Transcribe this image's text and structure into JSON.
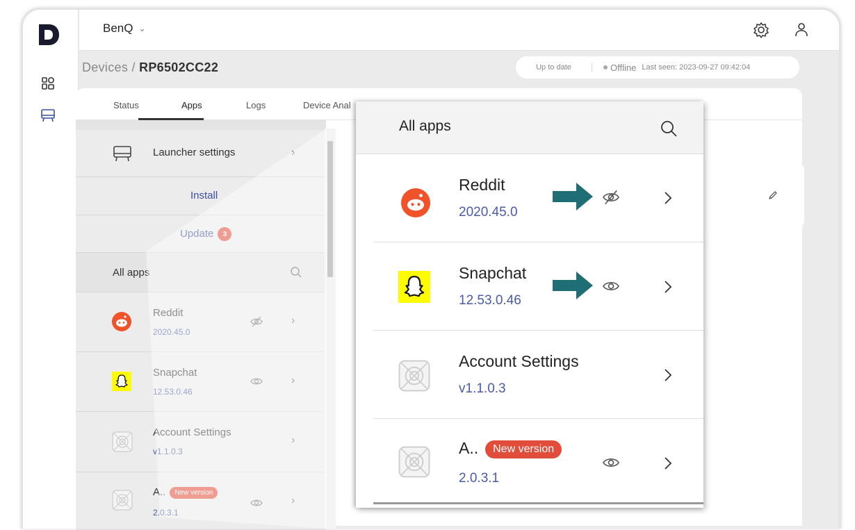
{
  "org": {
    "name": "BenQ"
  },
  "breadcrumb": {
    "root": "Devices",
    "separator": "/",
    "current": "RP6502CC22"
  },
  "status": {
    "update": "Up to date",
    "connection": "Offline",
    "last_seen": "Last seen: 2023-09-27 09:42:04"
  },
  "tabs": [
    "Status",
    "Apps",
    "Logs",
    "Device Anal"
  ],
  "launcher": {
    "label": "Launcher settings"
  },
  "actions": {
    "install": "Install",
    "update": "Update",
    "update_count": "3"
  },
  "all_apps": {
    "title": "All apps"
  },
  "apps": [
    {
      "name": "Reddit",
      "version": "2020.45.0",
      "visibility": "hidden",
      "icon": "reddit-icon"
    },
    {
      "name": "Snapchat",
      "version": "12.53.0.46",
      "visibility": "visible",
      "icon": "snapchat-icon"
    },
    {
      "name": "Account Settings",
      "version": "v1.1.0.3",
      "visibility": "none",
      "icon": "placeholder-app-icon"
    },
    {
      "name": "A..",
      "version": "2.0.3.1",
      "visibility": "visible",
      "icon": "placeholder-app-icon",
      "badge": "New version"
    }
  ],
  "colors": {
    "accent": "#3a4fa3",
    "badge": "#e24c3b",
    "arrow": "#1f6e75",
    "reddit": "#f0522a",
    "snapchat": "#fffc00"
  }
}
